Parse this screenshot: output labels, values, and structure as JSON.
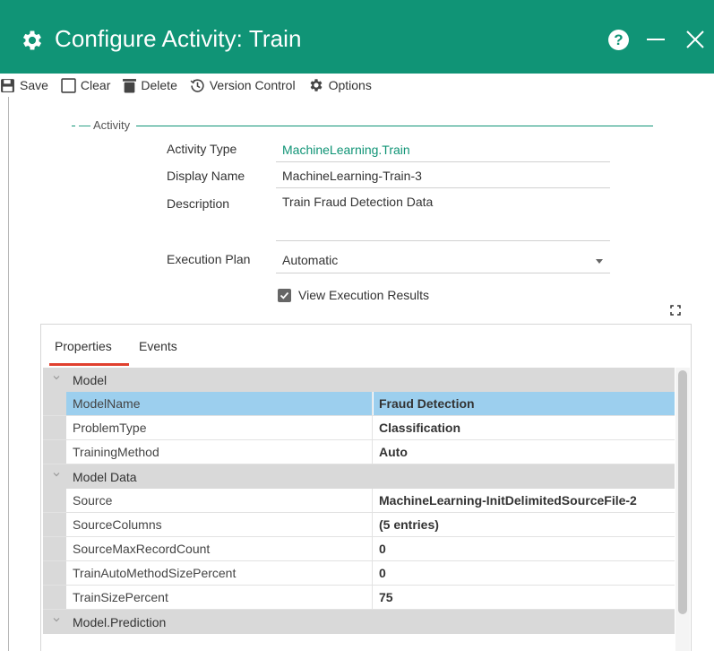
{
  "window": {
    "title": "Configure Activity: Train",
    "help_label": "?"
  },
  "toolbar": {
    "save": "Save",
    "clear": "Clear",
    "delete": "Delete",
    "version_control": "Version Control",
    "options": "Options"
  },
  "activity": {
    "section_label": "Activity",
    "fields": {
      "activity_type_label": "Activity Type",
      "activity_type_value": "MachineLearning.Train",
      "display_name_label": "Display Name",
      "display_name_value": "MachineLearning-Train-3",
      "description_label": "Description",
      "description_value": "Train Fraud Detection Data",
      "execution_plan_label": "Execution Plan",
      "execution_plan_value": "Automatic"
    },
    "view_execution_results": {
      "label": "View Execution Results",
      "checked": true
    }
  },
  "properties_panel": {
    "tabs": [
      "Properties",
      "Events"
    ],
    "active_tab": "Properties",
    "groups": [
      {
        "name": "Model",
        "rows": [
          {
            "name": "ModelName",
            "value": "Fraud Detection",
            "selected": true
          },
          {
            "name": "ProblemType",
            "value": "Classification"
          },
          {
            "name": "TrainingMethod",
            "value": "Auto"
          }
        ]
      },
      {
        "name": "Model Data",
        "rows": [
          {
            "name": "Source",
            "value": "MachineLearning-InitDelimitedSourceFile-2"
          },
          {
            "name": "SourceColumns",
            "value": "(5 entries)"
          },
          {
            "name": "SourceMaxRecordCount",
            "value": "0"
          },
          {
            "name": "TrainAutoMethodSizePercent",
            "value": "0"
          },
          {
            "name": "TrainSizePercent",
            "value": "75"
          }
        ]
      },
      {
        "name": "Model.Prediction",
        "rows": []
      }
    ]
  },
  "colors": {
    "accent": "#109476",
    "selected_row": "#9ccfee",
    "tab_underline": "#e0402e",
    "group_bg": "#d9d9d9"
  }
}
